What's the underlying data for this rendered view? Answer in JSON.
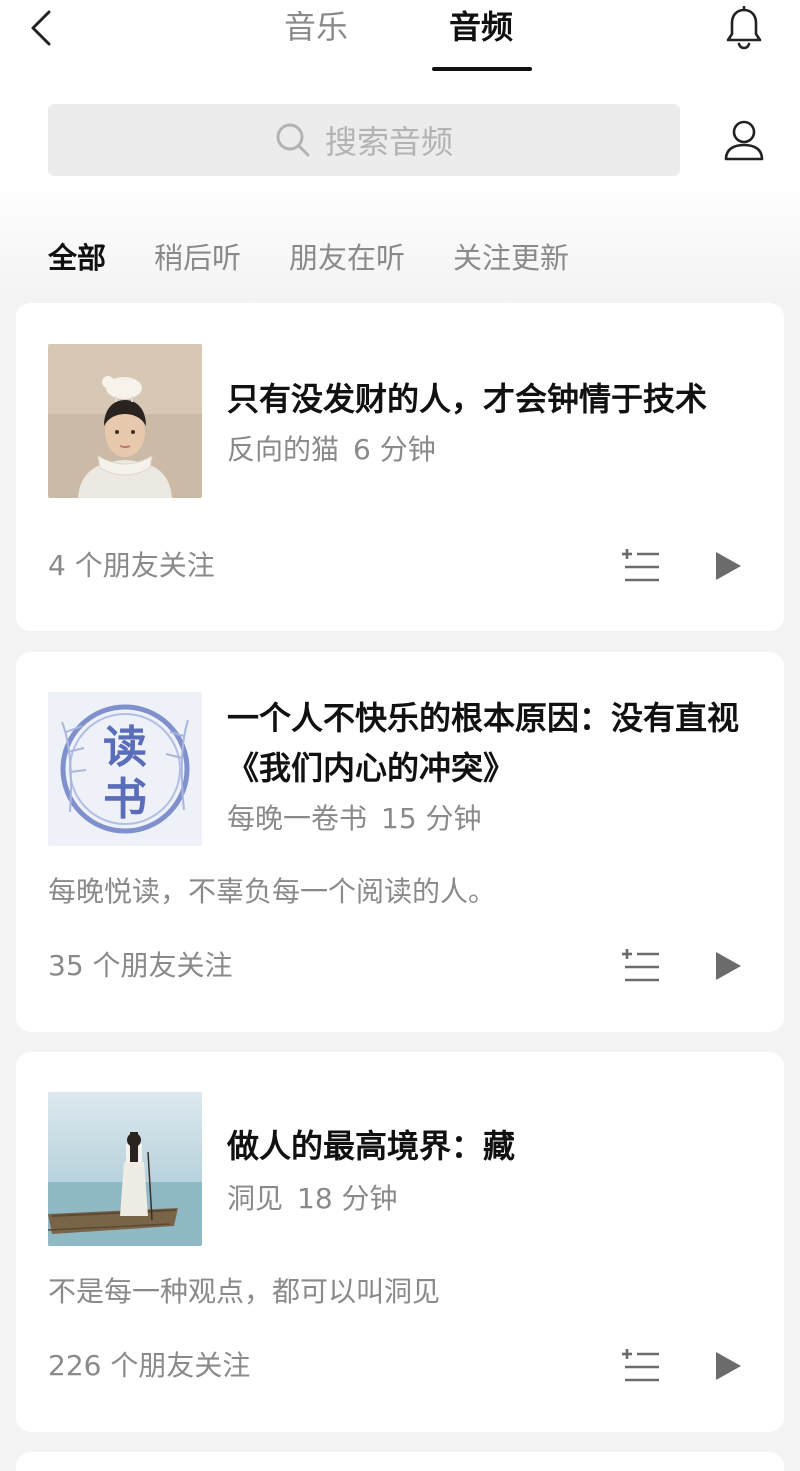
{
  "header": {
    "tabs": [
      "音乐",
      "音频"
    ],
    "active_tab": "音频"
  },
  "search": {
    "placeholder": "搜索音频"
  },
  "filters": [
    {
      "label": "全部",
      "active": true
    },
    {
      "label": "稍后听",
      "active": false
    },
    {
      "label": "朋友在听",
      "active": false
    },
    {
      "label": "关注更新",
      "active": false
    }
  ],
  "items": [
    {
      "title": "只有没发财的人，才会钟情于技术",
      "author": "反向的猫",
      "duration": "6 分钟",
      "description": "",
      "friends": "4 个朋友关注",
      "cover": "painting-portrait-with-lamb"
    },
    {
      "title": "一个人不快乐的根本原因：没有直视《我们内心的冲突》",
      "author": "每晚一卷书",
      "duration": "15 分钟",
      "description": "每晚悦读，不辜负每一个阅读的人。",
      "friends": "35 个朋友关注",
      "cover": "reading-logo",
      "cover_text": [
        "读",
        "书"
      ]
    },
    {
      "title": "做人的最高境界：藏",
      "author": "洞见",
      "duration": "18 分钟",
      "description": "不是每一种观点，都可以叫洞见",
      "friends": "226 个朋友关注",
      "cover": "woman-on-boat"
    }
  ],
  "colors": {
    "accent": "#111111",
    "muted": "#8a8a8a",
    "card_bg": "#ffffff",
    "page_bg": "#f3f3f3",
    "icon_gray": "#6b6b6b"
  }
}
